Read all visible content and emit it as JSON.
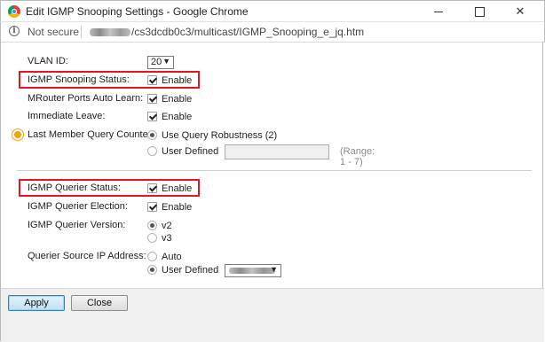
{
  "window": {
    "title": "Edit IGMP Snooping Settings - Google Chrome"
  },
  "address_bar": {
    "security_label": "Not secure",
    "url_path": "/cs3dcdb0c3/multicast/IGMP_Snooping_e_jq.htm"
  },
  "form": {
    "vlan_id": {
      "label": "VLAN ID:",
      "value": "20"
    },
    "snooping_status": {
      "label": "IGMP Snooping Status:",
      "option": "Enable",
      "checked": true
    },
    "mrouter_auto_learn": {
      "label": "MRouter Ports Auto Learn:",
      "option": "Enable",
      "checked": true
    },
    "immediate_leave": {
      "label": "Immediate Leave:",
      "option": "Enable",
      "checked": true
    },
    "last_member_query_counter": {
      "label": "Last Member Query Counter:",
      "options": [
        "Use Query Robustness (2)",
        "User Defined"
      ],
      "selected": "Use Query Robustness (2)",
      "user_defined_value": "",
      "range_hint": "(Range: 1 - 7)"
    },
    "querier_status": {
      "label": "IGMP Querier Status:",
      "option": "Enable",
      "checked": true
    },
    "querier_election": {
      "label": "IGMP Querier Election:",
      "option": "Enable",
      "checked": true
    },
    "querier_version": {
      "label": "IGMP Querier Version:",
      "options": [
        "v2",
        "v3"
      ],
      "selected": "v2"
    },
    "querier_source_ip": {
      "label": "Querier Source IP Address:",
      "options": [
        "Auto",
        "User Defined"
      ],
      "selected": "User Defined"
    }
  },
  "buttons": {
    "apply": "Apply",
    "close": "Close"
  },
  "colors": {
    "highlight_box": "#e6141e",
    "required_marker": "#f0a30a"
  }
}
